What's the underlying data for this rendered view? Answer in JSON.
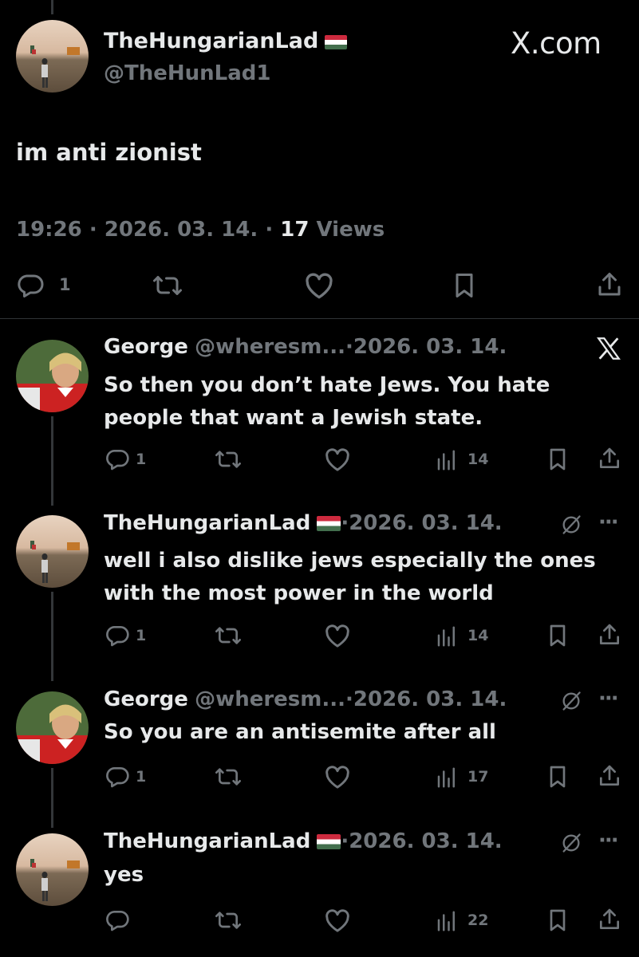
{
  "main_tweet": {
    "display_name": "TheHungarianLad",
    "handle": "@TheHunLad1",
    "text": "im anti zionist",
    "time": "19:26",
    "date": "2026. 03. 14.",
    "views_count": "17",
    "views_label": "Views",
    "reply_count": "1",
    "brand": "X.com"
  },
  "replies": [
    {
      "display_name": "George",
      "handle": "@wheresm...",
      "date": "2026. 03. 14.",
      "text_line1": "So then you don’t hate Jews. You hate",
      "text_line2": "people that want a Jewish state.",
      "reply_count": "1",
      "views": "14"
    },
    {
      "display_name": "TheHungarianLad",
      "date": "2026. 03. 14.",
      "text_line1": "well i also dislike jews especially the ones",
      "text_line2": "with the most power in the world",
      "reply_count": "1",
      "views": "14",
      "more": "···"
    },
    {
      "display_name": "George",
      "handle": "@wheresm...",
      "date": "2026. 03. 14.",
      "text_line1": "So you are an antisemite after all",
      "reply_count": "1",
      "views": "17",
      "more": "···"
    },
    {
      "display_name": "TheHungarianLad",
      "date": "2026. 03. 14.",
      "text_line1": "yes",
      "views": "22",
      "more": "···"
    }
  ],
  "sep": "·",
  "icons": [
    "reply-icon",
    "retweet-icon",
    "like-icon",
    "bookmark-icon",
    "share-icon",
    "views-icon",
    "x-logo-icon",
    "grok-icon",
    "more-icon"
  ],
  "colors": {
    "background": "#000000",
    "text": "#e7e9ea",
    "muted": "#71767b",
    "divider": "#2f3336"
  }
}
